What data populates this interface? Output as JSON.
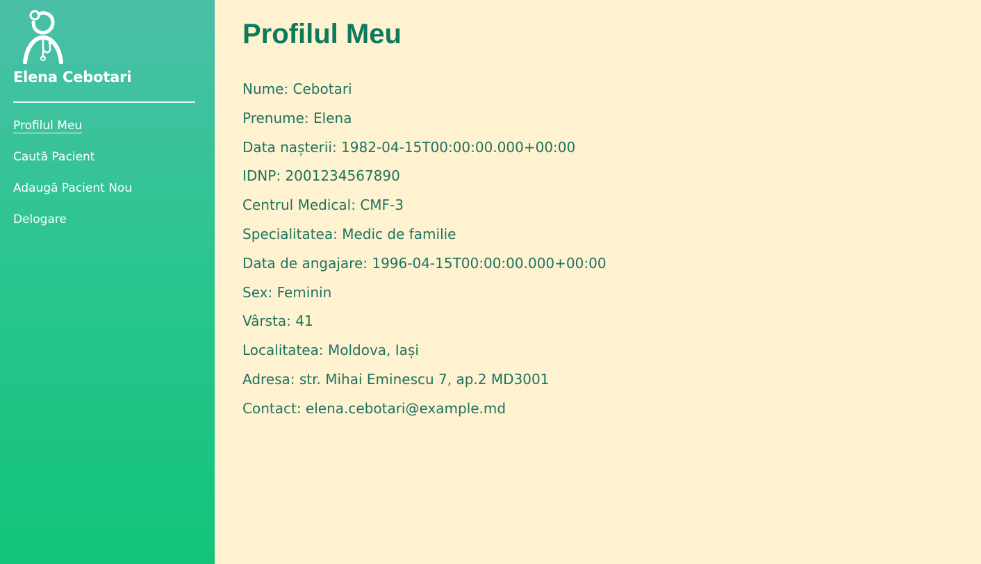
{
  "sidebar": {
    "user_name": "Elena Cebotari",
    "nav": [
      {
        "label": "Profilul Meu",
        "active": true
      },
      {
        "label": "Caută Pacient",
        "active": false
      },
      {
        "label": "Adaugă Pacient Nou",
        "active": false
      },
      {
        "label": "Delogare",
        "active": false
      }
    ]
  },
  "main": {
    "title": "Profilul Meu",
    "fields": [
      "Nume: Cebotari",
      "Prenume: Elena",
      "Data nașterii: 1982-04-15T00:00:00.000+00:00",
      "IDNP: 2001234567890",
      "Centrul Medical: CMF-3",
      "Specialitatea: Medic de familie",
      "Data de angajare: 1996-04-15T00:00:00.000+00:00",
      "Sex: Feminin",
      "Vârsta: 41",
      "Localitatea: Moldova, Iași",
      "Adresa: str. Mihai Eminescu 7, ap.2 MD3001",
      "Contact: elena.cebotari@example.md"
    ]
  },
  "icons": {
    "logo": "doctor-stethoscope-icon"
  },
  "colors": {
    "sidebar_top": "#4bbfa8",
    "sidebar_bottom": "#12c47a",
    "main_background": "#fff2d0",
    "title": "#0d7a5c",
    "field_text": "#1d7360"
  }
}
